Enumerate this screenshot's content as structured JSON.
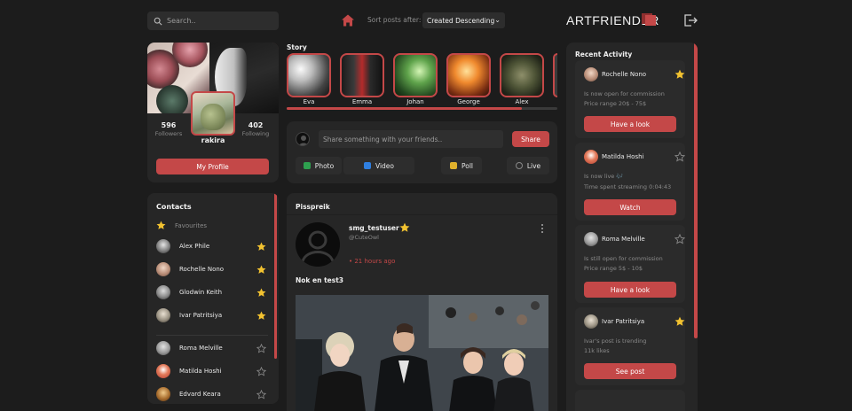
{
  "search": {
    "placeholder": "Search.."
  },
  "header": {
    "sort_label": "Sort posts after:",
    "sort_value": "Created Descending",
    "brand": "ARTFRIENDER",
    "accent": "#c44848"
  },
  "profile": {
    "followers_count": "596",
    "followers_label": "Followers",
    "following_count": "402",
    "following_label": "Following",
    "username": "rakira",
    "button": "My Profile"
  },
  "contacts": {
    "title": "Contacts",
    "favourites_label": "Favourites",
    "items": [
      {
        "name": "Alex Phile",
        "favourite": true
      },
      {
        "name": "Rochelle Nono",
        "favourite": true
      },
      {
        "name": "Glodwin Keith",
        "favourite": true
      },
      {
        "name": "Ivar Patritsiya",
        "favourite": true
      },
      {
        "name": "Roma Melville",
        "favourite": false
      },
      {
        "name": "Matilda Hoshi",
        "favourite": false
      },
      {
        "name": "Edvard Keara",
        "favourite": false
      }
    ]
  },
  "story": {
    "title": "Story",
    "items": [
      {
        "name": "Eva"
      },
      {
        "name": "Emma"
      },
      {
        "name": "Johan"
      },
      {
        "name": "George"
      },
      {
        "name": "Alex"
      }
    ]
  },
  "composer": {
    "placeholder": "Share something with your friends..",
    "share": "Share",
    "photo": "Photo",
    "video": "Video",
    "poll": "Poll",
    "live": "Live"
  },
  "feed": {
    "name": "Pisspreik",
    "post": {
      "user": "smg_testuser",
      "handle": "@CuteOwl",
      "time": "• 21 hours ago",
      "text": "Nok en test3"
    }
  },
  "recent": {
    "title": "Recent Activity",
    "items": [
      {
        "name": "Rochelle Nono",
        "favourite": true,
        "line1": "Is now open for commission",
        "line2": "Price range 20$ - 75$",
        "button": "Have a look"
      },
      {
        "name": "Matilda Hoshi",
        "favourite": false,
        "line1": "Is now live 🎶",
        "line2": "Time spent streaming 0:04:43",
        "button": "Watch"
      },
      {
        "name": "Roma Melville",
        "favourite": false,
        "line1": "Is still open for commission",
        "line2": "Price range 5$ - 10$",
        "button": "Have a look"
      },
      {
        "name": "Ivar Patritsiya",
        "favourite": true,
        "line1": "Ivar's post is trending",
        "line2": "11k likes",
        "button": "See post"
      }
    ]
  }
}
